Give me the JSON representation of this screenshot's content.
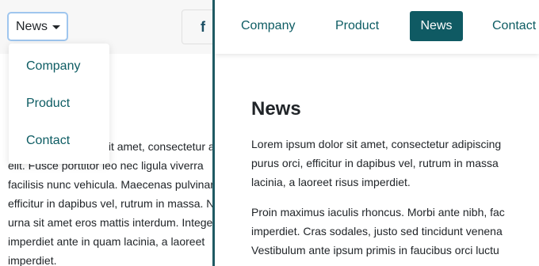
{
  "mobile": {
    "toggle_label": "News",
    "social_icon": "facebook-icon",
    "social_glyph": "f",
    "dropdown": [
      "Company",
      "Product",
      "Contact"
    ],
    "text_lines": [
      "Lorem ipsum dolor sit amet, consectetur adipiscing",
      "elit. Fusce porttitor leo nec ligula viverra",
      "facilisis nunc vehicula. Maecenas pulvinar",
      "efficitur in dapibus vel, rutrum in massa. Nam",
      "urna sit amet eros mattis interdum. Integer",
      "imperdiet ante in quam lacinia, a laoreet",
      "imperdiet."
    ]
  },
  "desktop": {
    "nav": [
      "Company",
      "Product",
      "Contact"
    ],
    "active_nav": "News",
    "heading": "News",
    "para1": [
      "Lorem ipsum dolor sit amet, consectetur adipiscing",
      "purus orci, efficitur in dapibus vel, rutrum in massa",
      "lacinia, a laoreet risus imperdiet."
    ],
    "para2": [
      "Proin maximus iaculis rhoncus. Morbi ante nibh, fac",
      "imperdiet. Cras sodales, justo sed tincidunt venena",
      "Vestibulum ante ipsum primis in faucibus orci luctu"
    ]
  },
  "colors": {
    "accent": "#0f5a63",
    "link": "#0d5c63",
    "divider": "#1f5a63"
  }
}
